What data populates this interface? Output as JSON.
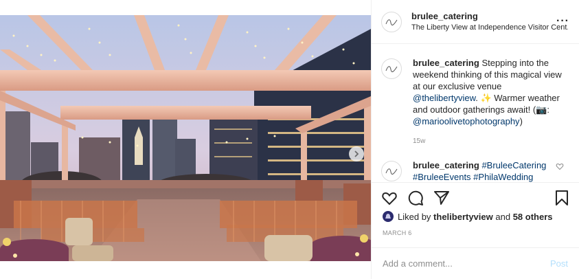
{
  "post": {
    "photo_alt": "",
    "carousel": {
      "count": 3,
      "active": 0
    }
  },
  "header": {
    "username": "brulee_catering",
    "location": "The Liberty View at Independence Visitor Cent..."
  },
  "caption": {
    "username": "brulee_catering",
    "text_1": " Stepping into the weekend thinking of this magical view at our exclusive venue ",
    "mention_1": "@thelibertyview",
    "text_2": ". ✨ Warmer weather and outdoor gatherings await! (📷: ",
    "mention_2": "@marioolivetophotography",
    "text_3": ")",
    "time": "15w"
  },
  "comment": {
    "username": "brulee_catering",
    "hashtags": "#BruleeCatering #BruleeEvents #PhilaWedding"
  },
  "likes": {
    "prefix": "Liked by ",
    "user": "thelibertyview",
    "middle": " and ",
    "others": "58 others"
  },
  "date": "MARCH 6",
  "add_comment": {
    "placeholder": "Add a comment...",
    "post_label": "Post"
  },
  "colors": {
    "link": "#00376b",
    "post_disabled": "#b2dffc",
    "carousel_active": "#3897f0"
  }
}
